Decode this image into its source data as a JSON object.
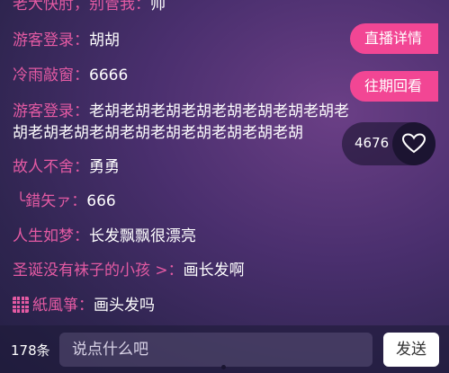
{
  "messages": [
    {
      "name": "老大快肘，别管我：",
      "text": "帅"
    },
    {
      "name": "游客登录：",
      "text": "胡胡"
    },
    {
      "name": "冷雨敲窗：",
      "text": "6666"
    },
    {
      "name": "游客登录：",
      "text": "老胡老胡老胡老胡老胡老胡老胡老胡老胡老胡老胡老胡老胡老胡老胡老胡老胡老胡"
    },
    {
      "name": "故人不舍：",
      "text": "勇勇"
    },
    {
      "name": "╰錯矢ァ：",
      "text": "666"
    },
    {
      "name": "人生如梦：",
      "text": "长发飘飘很漂亮"
    },
    {
      "name": "圣诞没有袜子的小孩 >：",
      "text": "画长发啊"
    },
    {
      "name": "紙風箏：",
      "text": "画头发吗"
    }
  ],
  "buttons": {
    "live_details": "直播详情",
    "past_replays": "往期回看"
  },
  "like": {
    "count": "4676"
  },
  "bottom": {
    "comment_count": "178条",
    "input_placeholder": "说点什么吧",
    "send_label": "发送"
  },
  "colors": {
    "accent": "#f24694",
    "username": "#e45aa3"
  }
}
